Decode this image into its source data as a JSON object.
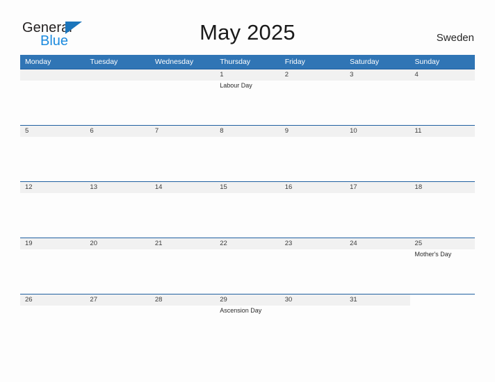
{
  "brand": {
    "name_top": "General",
    "name_bottom": "Blue",
    "accent_color": "#1b75bb",
    "accent_color_light": "#1b8ade"
  },
  "header": {
    "title": "May 2025",
    "region": "Sweden"
  },
  "calendar": {
    "header_bg": "#3075b5",
    "band_bg": "#f1f1f1",
    "rule_color": "#1f5fa0",
    "weekdays": [
      "Monday",
      "Tuesday",
      "Wednesday",
      "Thursday",
      "Friday",
      "Saturday",
      "Sunday"
    ],
    "weeks": [
      [
        {
          "day": ""
        },
        {
          "day": ""
        },
        {
          "day": ""
        },
        {
          "day": "1",
          "event": "Labour Day"
        },
        {
          "day": "2"
        },
        {
          "day": "3"
        },
        {
          "day": "4"
        }
      ],
      [
        {
          "day": "5"
        },
        {
          "day": "6"
        },
        {
          "day": "7"
        },
        {
          "day": "8"
        },
        {
          "day": "9"
        },
        {
          "day": "10"
        },
        {
          "day": "11"
        }
      ],
      [
        {
          "day": "12"
        },
        {
          "day": "13"
        },
        {
          "day": "14"
        },
        {
          "day": "15"
        },
        {
          "day": "16"
        },
        {
          "day": "17"
        },
        {
          "day": "18"
        }
      ],
      [
        {
          "day": "19"
        },
        {
          "day": "20"
        },
        {
          "day": "21"
        },
        {
          "day": "22"
        },
        {
          "day": "23"
        },
        {
          "day": "24"
        },
        {
          "day": "25",
          "event": "Mother's Day"
        }
      ],
      [
        {
          "day": "26"
        },
        {
          "day": "27"
        },
        {
          "day": "28"
        },
        {
          "day": "29",
          "event": "Ascension Day"
        },
        {
          "day": "30"
        },
        {
          "day": "31"
        },
        {
          "day": ""
        }
      ]
    ]
  }
}
